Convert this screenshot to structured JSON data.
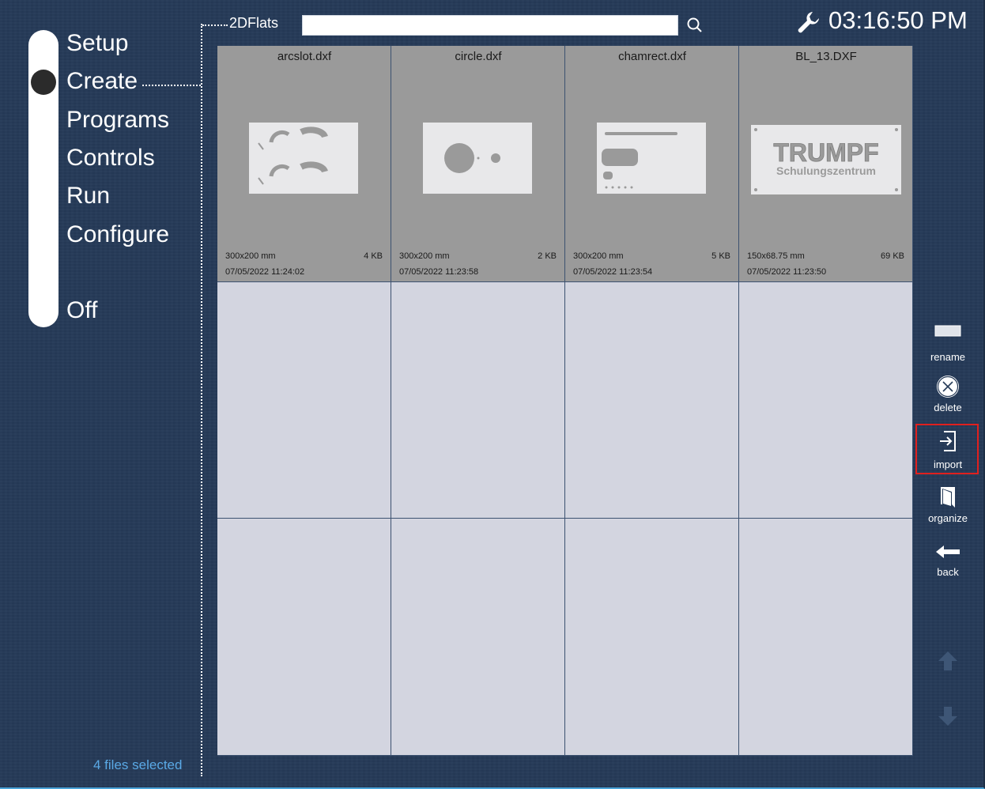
{
  "nav": {
    "setup": "Setup",
    "create": "Create",
    "programs": "Programs",
    "controls": "Controls",
    "run": "Run",
    "configure": "Configure",
    "off": "Off",
    "active_item": "Create"
  },
  "breadcrumb": "2DFlats",
  "search": {
    "value": "",
    "icon": "search-icon"
  },
  "header": {
    "time": "03:16:50 PM",
    "service_icon": "wrench-icon"
  },
  "files": [
    {
      "name": "arcslot.dxf",
      "size": "300x200 mm",
      "file_size": "4 KB",
      "date": "07/05/2022 11:24:02"
    },
    {
      "name": "circle.dxf",
      "size": "300x200 mm",
      "file_size": "2 KB",
      "date": "07/05/2022 11:23:58"
    },
    {
      "name": "chamrect.dxf",
      "size": "300x200 mm",
      "file_size": "5 KB",
      "date": "07/05/2022 11:23:54"
    },
    {
      "name": "BL_13.DXF",
      "size": "150x68.75 mm",
      "file_size": "69 KB",
      "date": "07/05/2022 11:23:50",
      "thumb_text_1": "TRUMPF",
      "thumb_text_2": "Schulungszentrum"
    }
  ],
  "actions": {
    "rename": "rename",
    "delete": "delete",
    "import": "import",
    "organize": "organize",
    "back": "back"
  },
  "status": "4 files selected",
  "colors": {
    "background": "#253a57",
    "file_cell": "#9a9a9a",
    "empty_cell": "#d3d5e0",
    "status_text": "#5aa9e6",
    "highlight": "#e0201e"
  }
}
